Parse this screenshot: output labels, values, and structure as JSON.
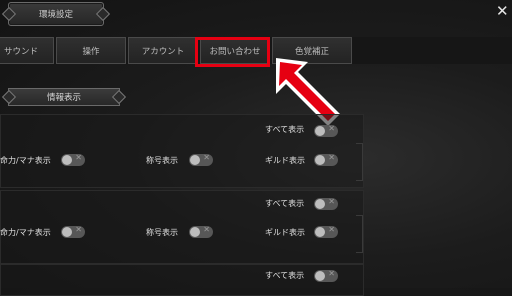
{
  "window": {
    "title": "環境設定"
  },
  "tabs": [
    {
      "label": "サウンド"
    },
    {
      "label": "操作"
    },
    {
      "label": "アカウント"
    },
    {
      "label": "お問い合わせ"
    },
    {
      "label": "色覚補正"
    }
  ],
  "section": {
    "title": "情報表示"
  },
  "groups": [
    {
      "all_label": "すべて表示",
      "items": [
        "命力/マナ表示",
        "称号表示",
        "ギルド表示"
      ]
    },
    {
      "all_label": "すべて表示",
      "items": [
        "命力/マナ表示",
        "称号表示",
        "ギルド表示"
      ]
    },
    {
      "all_label": "すべて表示"
    }
  ],
  "icons": {
    "close": "close-icon",
    "toggle_off": "close-icon",
    "pointer": "arrow-icon"
  },
  "colors": {
    "highlight": "#e60012"
  }
}
